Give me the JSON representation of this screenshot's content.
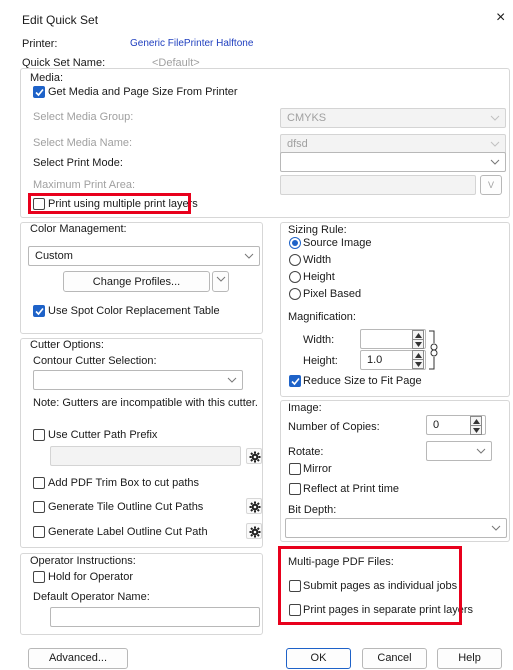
{
  "dialog": {
    "title": "Edit Quick Set",
    "close_glyph": "×"
  },
  "header": {
    "printer_label": "Printer:",
    "printer_value": "Generic FilePrinter Halftone",
    "quick_set_label": "Quick Set Name:",
    "quick_set_value": "<Default>"
  },
  "media": {
    "group_label": "Media:",
    "get_media_label": "Get Media and Page Size From Printer",
    "get_media_checked": true,
    "media_group_label": "Select Media Group:",
    "media_group_value": "CMYKS",
    "media_name_label": "Select Media Name:",
    "media_name_value": "dfsd",
    "print_mode_label": "Select Print Mode:",
    "print_mode_value": "",
    "max_area_label": "Maximum Print Area:",
    "max_area_btn": "V",
    "multi_layers_label": "Print using multiple print layers",
    "multi_layers_checked": false
  },
  "color": {
    "group_label": "Color Management:",
    "value": "Custom",
    "change_profiles_label": "Change Profiles...",
    "spot_label": "Use Spot Color Replacement Table",
    "spot_checked": true
  },
  "cutter": {
    "group_label": "Cutter Options:",
    "contour_label": "Contour Cutter Selection:",
    "contour_value": "",
    "note": "Note: Gutters are incompatible with this cutter.",
    "prefix_label": "Use Cutter Path Prefix",
    "prefix_checked": false,
    "trim_label": "Add PDF Trim Box to cut paths",
    "trim_checked": false,
    "tile_label": "Generate Tile Outline Cut Paths",
    "tile_checked": false,
    "label_label": "Generate Label Outline Cut Path",
    "label_checked": false
  },
  "operator": {
    "group_label": "Operator Instructions:",
    "hold_label": "Hold for Operator",
    "hold_checked": false,
    "name_label": "Default Operator Name:",
    "name_value": ""
  },
  "sizing": {
    "group_label": "Sizing Rule:",
    "options": [
      "Source Image",
      "Width",
      "Height",
      "Pixel Based"
    ],
    "selected": "Source Image",
    "magnification_label": "Magnification:",
    "width_label": "Width:",
    "width_value": "",
    "height_label": "Height:",
    "height_value": "1.0",
    "reduce_label": "Reduce Size to Fit Page",
    "reduce_checked": true
  },
  "image": {
    "group_label": "Image:",
    "copies_label": "Number of Copies:",
    "copies_value": "0",
    "rotate_label": "Rotate:",
    "rotate_value": "",
    "mirror_label": "Mirror",
    "mirror_checked": false,
    "reflect_label": "Reflect at Print time",
    "reflect_checked": false,
    "bitdepth_label": "Bit Depth:",
    "bitdepth_value": ""
  },
  "pdf": {
    "group_label": "Multi-page PDF Files:",
    "submit_label": "Submit pages as individual jobs",
    "submit_checked": false,
    "layers_label": "Print pages in separate print layers",
    "layers_checked": false
  },
  "footer": {
    "advanced_label": "Advanced...",
    "ok_label": "OK",
    "cancel_label": "Cancel",
    "help_label": "Help"
  },
  "colors": {
    "accent": "#1e62c8",
    "highlight": "#e8001c",
    "link": "#1f3fbf"
  }
}
